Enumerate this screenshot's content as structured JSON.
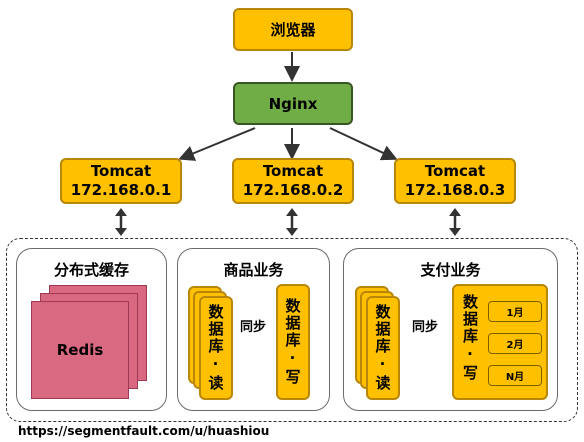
{
  "browser": {
    "label": "浏览器"
  },
  "nginx": {
    "label": "Nginx"
  },
  "tomcats": [
    {
      "name": "Tomcat",
      "ip": "172.168.0.1"
    },
    {
      "name": "Tomcat",
      "ip": "172.168.0.2"
    },
    {
      "name": "Tomcat",
      "ip": "172.168.0.3"
    }
  ],
  "cache": {
    "title": "分布式缓存",
    "item": "Redis"
  },
  "product": {
    "title": "商品业务",
    "read_db": "数据库·读",
    "sync": "同步",
    "write_db": "数据库·写"
  },
  "payment": {
    "title": "支付业务",
    "read_db": "数据库·读",
    "sync": "同步",
    "write_db": "数据库·写",
    "months": [
      "1月",
      "2月",
      "N月"
    ]
  },
  "footer": {
    "url": "https://segmentfault.com/u/huashiou"
  },
  "colors": {
    "box": "#ffc000",
    "nginx": "#70ad47",
    "redis": "#d96881"
  }
}
